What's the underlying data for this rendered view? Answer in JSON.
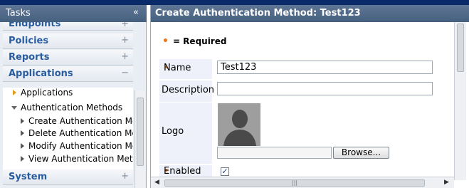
{
  "sidebar": {
    "title": "Tasks",
    "collapse_icon": "«",
    "sections": [
      {
        "label": "Endpoints",
        "sign": "+"
      },
      {
        "label": "Policies",
        "sign": "+"
      },
      {
        "label": "Reports",
        "sign": "+"
      },
      {
        "label": "Applications",
        "sign": "−"
      },
      {
        "label": "System",
        "sign": "+"
      }
    ],
    "tree": {
      "applications": "Applications",
      "auth_methods": "Authentication Methods",
      "children": [
        "Create Authentication Method",
        "Delete Authentication Method",
        "Modify Authentication Method",
        "View Authentication Method"
      ]
    }
  },
  "panel": {
    "title": "Create Authentication Method: Test123",
    "required_note": "= Required",
    "required_marker": "•",
    "fields": {
      "name_label": "Name",
      "name_value": "Test123",
      "description_label": "Description",
      "description_value": "",
      "logo_label": "Logo",
      "browse_label": "Browse...",
      "enabled_label": "Enabled",
      "enabled_checked": true
    }
  },
  "colors": {
    "header_bg": "#4f6a8a",
    "section_text": "#2a5da0",
    "required": "#e8761c",
    "label_bg": "#eef1fa"
  }
}
